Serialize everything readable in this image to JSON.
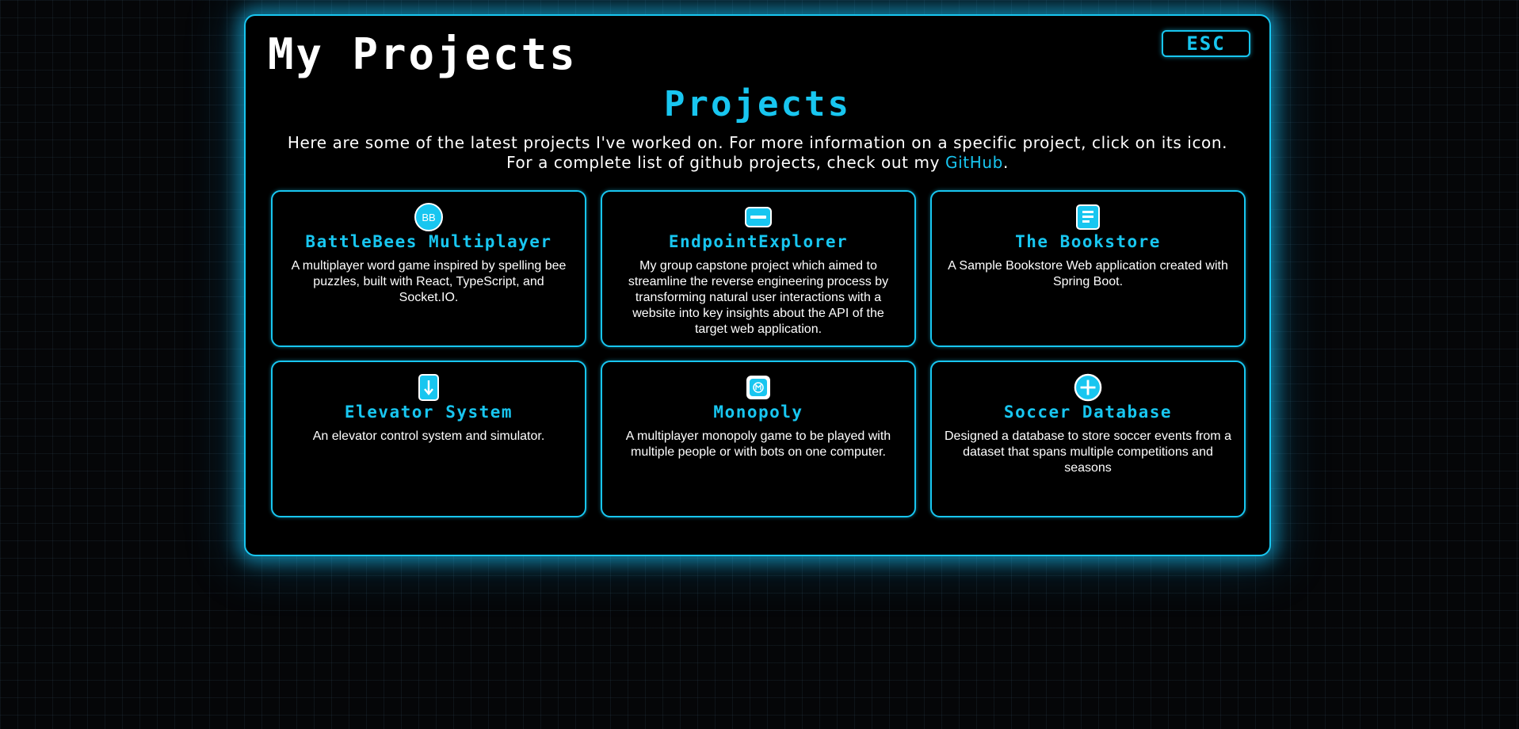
{
  "window": {
    "title": "My Projects",
    "esc_label": "ESC"
  },
  "section": {
    "heading": "Projects",
    "intro_before": "Here are some of the latest projects I've worked on. For more information on a specific project, click on its icon. For a complete list of github projects, check out my ",
    "intro_link": "GitHub",
    "intro_after": "."
  },
  "colors": {
    "accent": "#18c6f0",
    "background": "#000000",
    "text": "#ffffff"
  },
  "projects": [
    {
      "icon": "battlebees-logo-icon",
      "icon_text": "BB",
      "title": "BattleBees Multiplayer",
      "description": "A multiplayer word game inspired by spelling bee puzzles, built with React, TypeScript, and Socket.IO."
    },
    {
      "icon": "api-endpoint-icon",
      "title": "EndpointExplorer",
      "description": "My group capstone project which aimed to streamline the reverse engineering process by transforming natural user interactions with a website into key insights about the API of the target web application."
    },
    {
      "icon": "document-icon",
      "title": "The Bookstore",
      "description": "A Sample Bookstore Web application created with Spring Boot."
    },
    {
      "icon": "elevator-down-icon",
      "title": "Elevator System",
      "description": "An elevator control system and simulator."
    },
    {
      "icon": "monopoly-icon",
      "title": "Monopoly",
      "description": "A multiplayer monopoly game to be played with multiple people or with bots on one computer."
    },
    {
      "icon": "plus-circle-icon",
      "title": "Soccer Database",
      "description": "Designed a database to store soccer events from a dataset that spans multiple competitions and seasons"
    }
  ]
}
